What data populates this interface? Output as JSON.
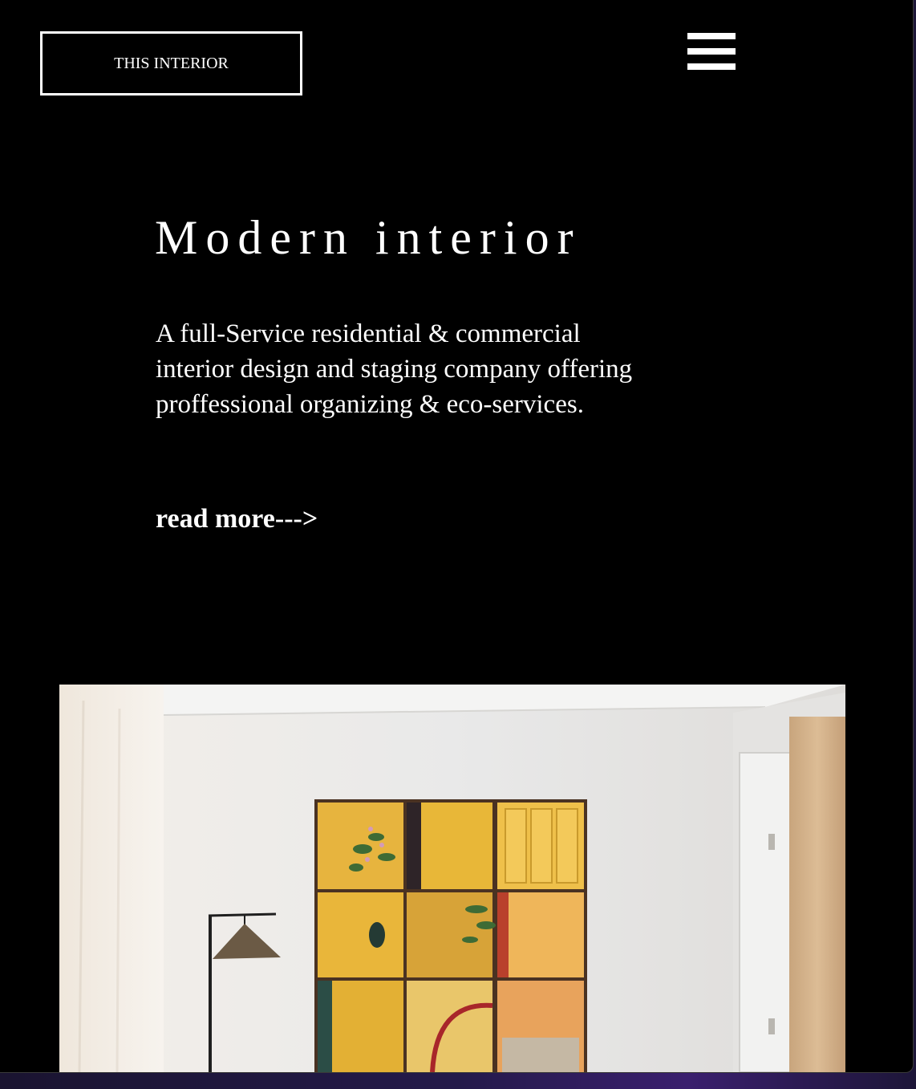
{
  "header": {
    "logo_text": "THIS INTERIOR",
    "menu_icon": "hamburger-menu-icon"
  },
  "hero": {
    "title": "Modern interior",
    "description": "A full-Service residential & commercial interior design and staging company offering proffessional organizing & eco-services.",
    "read_more": "read more--->"
  },
  "colors": {
    "background": "#000000",
    "text": "#ffffff",
    "panel_yellow": "#e8b33a",
    "frame_brown": "#4a3222"
  }
}
